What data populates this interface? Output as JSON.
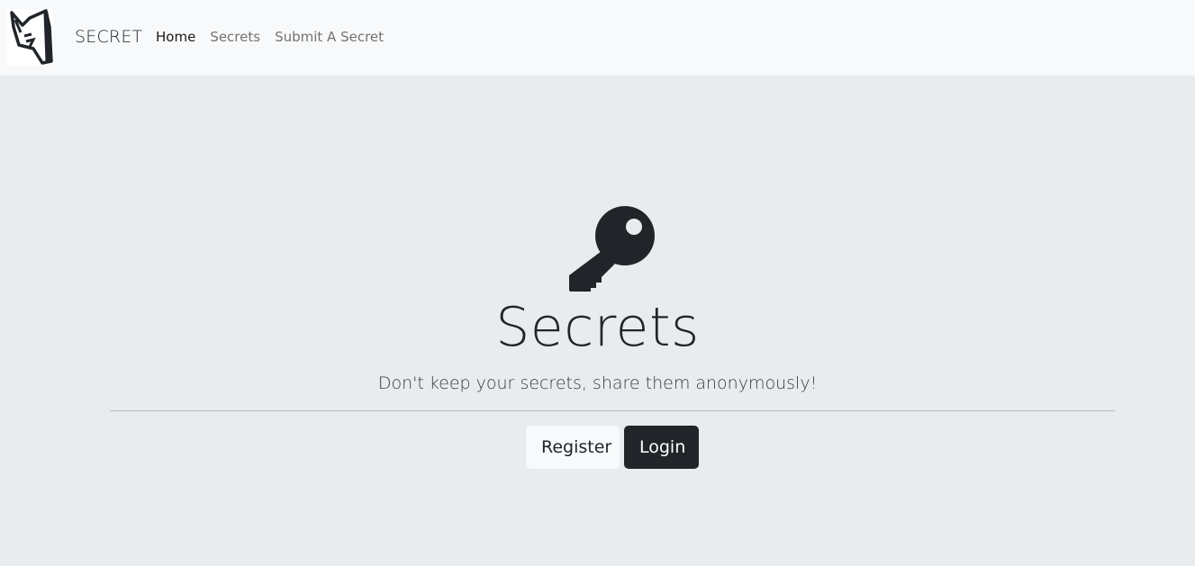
{
  "navbar": {
    "brand": "SECRET",
    "links": [
      {
        "label": "Home",
        "active": true
      },
      {
        "label": "Secrets",
        "active": false
      },
      {
        "label": "Submit A Secret",
        "active": false
      }
    ]
  },
  "hero": {
    "icon": "key-icon",
    "title": "Secrets",
    "lead": "Don't keep your secrets, share them anonymously!",
    "register_label": "Register",
    "login_label": "Login"
  },
  "colors": {
    "navbar_bg": "#f8f9fa",
    "page_bg": "#e9ecef",
    "dark": "#212529",
    "light_button": "#f8f9fa"
  }
}
